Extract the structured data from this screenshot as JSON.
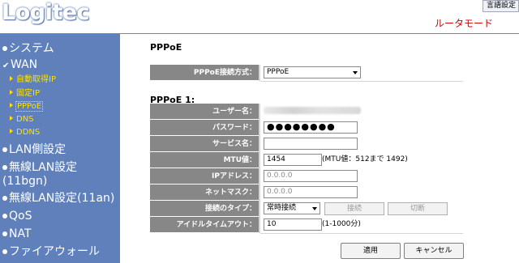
{
  "header": {
    "logo": "Logitec",
    "lang_button": "言語設定",
    "mode": "ルータモード"
  },
  "sidebar": {
    "items": [
      {
        "label": "システム"
      },
      {
        "label": "WAN"
      },
      {
        "label": "LAN側設定"
      },
      {
        "label": "無線LAN設定"
      },
      {
        "label": "(11bgn)"
      },
      {
        "label": "無線LAN設定(11an)"
      },
      {
        "label": "QoS"
      },
      {
        "label": "NAT"
      },
      {
        "label": "ファイアウォール"
      }
    ],
    "wan_sub": [
      {
        "label": "自動取得IP"
      },
      {
        "label": "固定IP"
      },
      {
        "label": "PPPoE"
      },
      {
        "label": "DNS"
      },
      {
        "label": "DDNS"
      }
    ]
  },
  "main": {
    "title": "PPPoE",
    "connection_method_label": "PPPoE接続方式：",
    "connection_method_value": "PPPoE",
    "section_title": "PPPoE 1:",
    "fields": {
      "user_label": "ユーザー名：",
      "password_label": "パスワード：",
      "password_value": "●●●●●●●●",
      "service_label": "サービス名：",
      "service_value": "",
      "mtu_label": "MTU値：",
      "mtu_value": "1454",
      "mtu_note": "(MTU値：512まで 1492)",
      "ip_label": "IPアドレス：",
      "ip_value": "0.0.0.0",
      "mask_label": "ネットマスク：",
      "mask_value": "0.0.0.0",
      "type_label": "接続のタイプ：",
      "type_value": "常時接続",
      "connect_button": "接続",
      "disconnect_button": "切断",
      "idle_label": "アイドルタイムアウト：",
      "idle_value": "10",
      "idle_note": "(1-1000分)"
    },
    "apply_button": "適用",
    "cancel_button": "キャンセル"
  }
}
